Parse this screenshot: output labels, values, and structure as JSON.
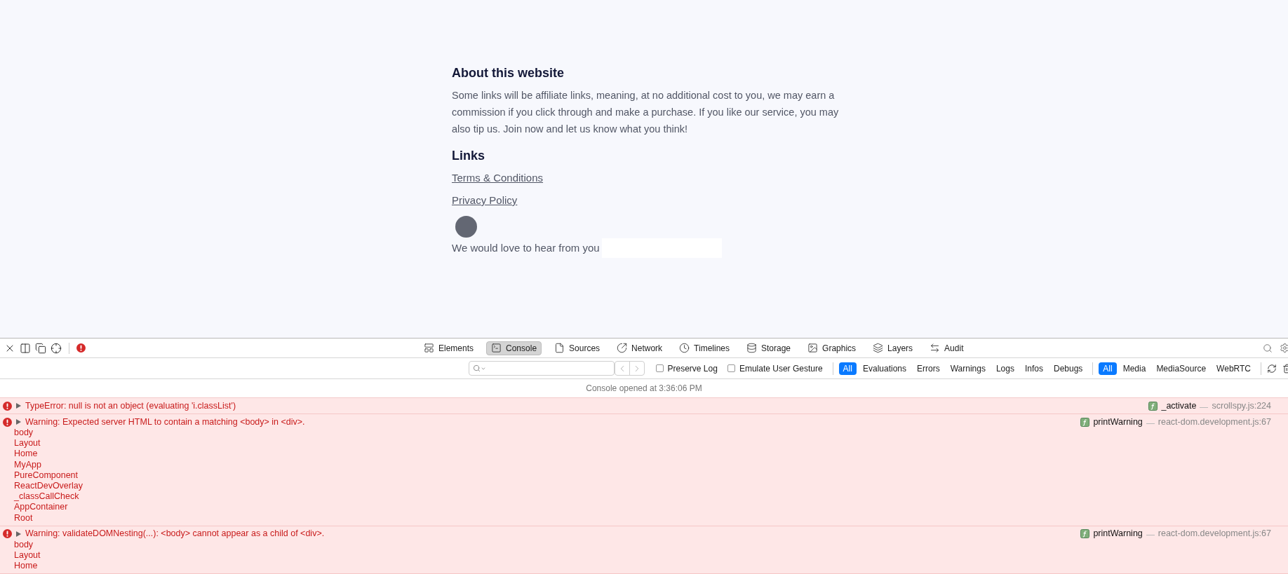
{
  "page": {
    "about_heading": "About this website",
    "about_text": "Some links will be affiliate links, meaning, at no additional cost to you, we may earn a commission if you click through and make a purchase. If you like our service, you may also tip us. Join now and let us know what you think!",
    "links_heading": "Links",
    "links": [
      "Terms & Conditions",
      "Privacy Policy"
    ],
    "feedback_text": "We would love to hear from you"
  },
  "devtools": {
    "tabs": [
      {
        "label": "Elements",
        "selected": false
      },
      {
        "label": "Console",
        "selected": true
      },
      {
        "label": "Sources",
        "selected": false
      },
      {
        "label": "Network",
        "selected": false
      },
      {
        "label": "Timelines",
        "selected": false
      },
      {
        "label": "Storage",
        "selected": false
      },
      {
        "label": "Graphics",
        "selected": false
      },
      {
        "label": "Layers",
        "selected": false
      },
      {
        "label": "Audit",
        "selected": false
      }
    ],
    "checkboxes": [
      {
        "label": "Preserve Log",
        "checked": false
      },
      {
        "label": "Emulate User Gesture",
        "checked": false
      }
    ],
    "level_filters": [
      {
        "label": "All",
        "selected": true
      },
      {
        "label": "Evaluations",
        "selected": false
      },
      {
        "label": "Errors",
        "selected": false
      },
      {
        "label": "Warnings",
        "selected": false
      },
      {
        "label": "Logs",
        "selected": false
      },
      {
        "label": "Infos",
        "selected": false
      },
      {
        "label": "Debugs",
        "selected": false
      }
    ],
    "source_filters": [
      {
        "label": "All",
        "selected": true
      },
      {
        "label": "Media",
        "selected": false
      },
      {
        "label": "MediaSource",
        "selected": false
      },
      {
        "label": "WebRTC",
        "selected": false
      }
    ],
    "console_opened": "Console opened at 3:36:06 PM",
    "messages": [
      {
        "kind": "error",
        "expanded": false,
        "text": "TypeError: null is not an object (evaluating 'i.classList')",
        "function": "_activate",
        "location": "scrollspy.js:224"
      },
      {
        "kind": "error",
        "expanded": false,
        "text": "Warning: Expected server HTML to contain a matching <body> in <div>.",
        "stack": [
          "body",
          "Layout",
          "Home",
          "MyApp",
          "PureComponent",
          "ReactDevOverlay",
          "_classCallCheck",
          "AppContainer",
          "Root"
        ],
        "function": "printWarning",
        "location": "react-dom.development.js:67"
      },
      {
        "kind": "error",
        "expanded": false,
        "text": "Warning: validateDOMNesting(...): <body> cannot appear as a child of <div>.",
        "stack": [
          "body",
          "Layout",
          "Home"
        ],
        "function": "printWarning",
        "location": "react-dom.development.js:67"
      }
    ]
  }
}
